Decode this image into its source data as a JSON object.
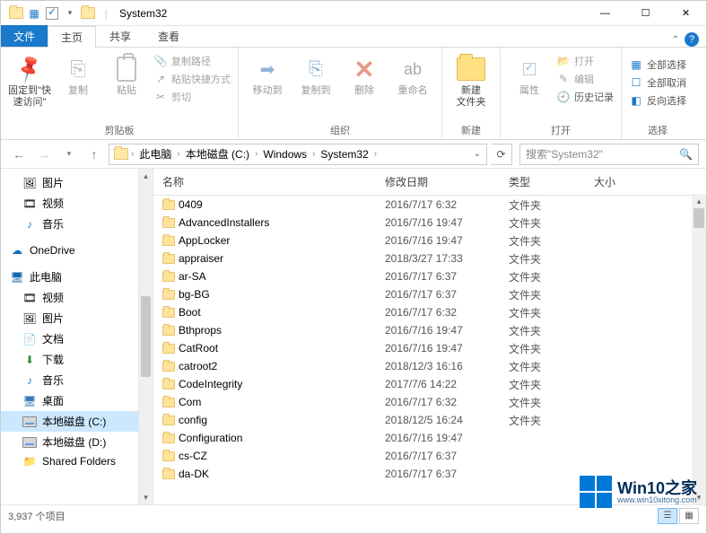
{
  "window": {
    "title": "System32"
  },
  "tabs": {
    "file": "文件",
    "home": "主页",
    "share": "共享",
    "view": "查看"
  },
  "ribbon": {
    "pin": "固定到\"快\n速访问\"",
    "copy": "复制",
    "paste": "粘贴",
    "copy_path": "复制路径",
    "paste_shortcut": "粘贴快捷方式",
    "cut": "剪切",
    "clipboard_group": "剪贴板",
    "move_to": "移动到",
    "copy_to": "复制到",
    "delete": "删除",
    "rename": "重命名",
    "organize_group": "组织",
    "new_folder": "新建\n文件夹",
    "new_group": "新建",
    "properties": "属性",
    "open": "打开",
    "edit": "编辑",
    "history": "历史记录",
    "open_group": "打开",
    "select_all": "全部选择",
    "select_none": "全部取消",
    "invert_selection": "反向选择",
    "select_group": "选择"
  },
  "breadcrumb": {
    "items": [
      "此电脑",
      "本地磁盘 (C:)",
      "Windows",
      "System32"
    ]
  },
  "search": {
    "placeholder": "搜索\"System32\""
  },
  "sidebar": {
    "items": [
      {
        "label": "图片",
        "icon": "🖼",
        "lv": 1
      },
      {
        "label": "视频",
        "icon": "🎞",
        "lv": 1
      },
      {
        "label": "音乐",
        "icon": "♪",
        "lv": 1,
        "color": "#1979CA"
      },
      {
        "label": "OneDrive",
        "icon": "☁",
        "lv": 0,
        "spaceBefore": true,
        "color": "#0a6dc2"
      },
      {
        "label": "此电脑",
        "icon": "🖥",
        "lv": 0,
        "spaceBefore": true,
        "color": "#1566a8"
      },
      {
        "label": "视频",
        "icon": "🎞",
        "lv": 1
      },
      {
        "label": "图片",
        "icon": "🖼",
        "lv": 1
      },
      {
        "label": "文档",
        "icon": "📄",
        "lv": 1
      },
      {
        "label": "下载",
        "icon": "⬇",
        "lv": 1,
        "color": "#2f8f3a"
      },
      {
        "label": "音乐",
        "icon": "♪",
        "lv": 1,
        "color": "#1979CA"
      },
      {
        "label": "桌面",
        "icon": "🖥",
        "lv": 1,
        "color": "#3a78bd"
      },
      {
        "label": "本地磁盘 (C:)",
        "icon": "drive",
        "lv": 1,
        "selected": true
      },
      {
        "label": "本地磁盘 (D:)",
        "icon": "drive",
        "lv": 1
      },
      {
        "label": "Shared Folders",
        "icon": "📁",
        "lv": 1,
        "color": "#c0392b"
      }
    ]
  },
  "columns": {
    "name": "名称",
    "date": "修改日期",
    "type": "类型",
    "size": "大小"
  },
  "files": [
    {
      "name": "0409",
      "date": "2016/7/17 6:32",
      "type": "文件夹"
    },
    {
      "name": "AdvancedInstallers",
      "date": "2016/7/16 19:47",
      "type": "文件夹"
    },
    {
      "name": "AppLocker",
      "date": "2016/7/16 19:47",
      "type": "文件夹"
    },
    {
      "name": "appraiser",
      "date": "2018/3/27 17:33",
      "type": "文件夹"
    },
    {
      "name": "ar-SA",
      "date": "2016/7/17 6:37",
      "type": "文件夹"
    },
    {
      "name": "bg-BG",
      "date": "2016/7/17 6:37",
      "type": "文件夹"
    },
    {
      "name": "Boot",
      "date": "2016/7/17 6:32",
      "type": "文件夹"
    },
    {
      "name": "Bthprops",
      "date": "2016/7/16 19:47",
      "type": "文件夹"
    },
    {
      "name": "CatRoot",
      "date": "2016/7/16 19:47",
      "type": "文件夹"
    },
    {
      "name": "catroot2",
      "date": "2018/12/3 16:16",
      "type": "文件夹"
    },
    {
      "name": "CodeIntegrity",
      "date": "2017/7/6 14:22",
      "type": "文件夹"
    },
    {
      "name": "Com",
      "date": "2016/7/17 6:32",
      "type": "文件夹"
    },
    {
      "name": "config",
      "date": "2018/12/5 16:24",
      "type": "文件夹"
    },
    {
      "name": "Configuration",
      "date": "2016/7/16 19:47",
      "type": ""
    },
    {
      "name": "cs-CZ",
      "date": "2016/7/17 6:37",
      "type": ""
    },
    {
      "name": "da-DK",
      "date": "2016/7/17 6:37",
      "type": ""
    }
  ],
  "status": {
    "count": "3,937 个项目"
  },
  "watermark": {
    "title": "Win10之家",
    "url": "www.win10xitong.com"
  }
}
